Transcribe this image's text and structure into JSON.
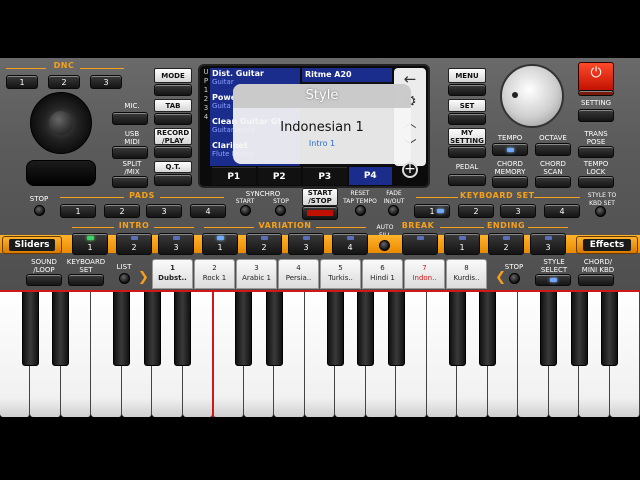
{
  "dnc": {
    "label": "DNC",
    "buttons": [
      "1",
      "2",
      "3"
    ]
  },
  "left": {
    "mic_label": "MIC.",
    "usb_midi_label": "USB\nMIDI",
    "split_mix_label": "SPLIT\n/MIX"
  },
  "mid_buttons": {
    "mode": "MODE",
    "tab": "TAB",
    "record_play": "RECORD\n/PLAY",
    "qt": "Q.T."
  },
  "screen": {
    "list": [
      {
        "name": "Dist. Guitar",
        "sub": "Guitar"
      },
      {
        "name": "Powe",
        "sub": "Guita"
      },
      {
        "name": "Clean Guitar Gt",
        "sub": "Guitar amily"
      },
      {
        "name": "Clarinet",
        "sub": "Flute Family"
      }
    ],
    "rhythm_label": "Ritme A20",
    "side_marks": [
      "U",
      "P",
      "1",
      "2",
      "3",
      "4"
    ],
    "tabs": [
      "P1",
      "P2",
      "P3",
      "P4"
    ],
    "active_tab": "P4",
    "popup_title": "Style",
    "popup_name": "Indonesian 1",
    "popup_sub": "Intro 1"
  },
  "right": {
    "menu": "MENU",
    "set": "SET",
    "my_setting": "MY\nSETTING",
    "pedal": "PEDAL",
    "setting": "SETTING",
    "tempo": "TEMPO",
    "octave": "OCTAVE",
    "transpose": "TRANS\nPOSE",
    "chord_memory": "CHORD\nMEMORY",
    "chord_scan": "CHORD\nSCAN",
    "tempo_lock": "TEMPO\nLOCK"
  },
  "pads": {
    "label": "PADS",
    "stop_label": "STOP",
    "buttons": [
      "1",
      "2",
      "3",
      "4"
    ]
  },
  "start_stop": "START\n/STOP",
  "synchro": {
    "label": "SYNCHRO",
    "start": "START",
    "stop": "STOP"
  },
  "reset": "RESET\nTAP TEMPO",
  "fade": "FADE\nIN/OUT",
  "keyboard_set": {
    "label": "KEYBOARD SET",
    "buttons": [
      "1",
      "2",
      "3",
      "4"
    ],
    "style_to": "STYLE TO\nKBD SET"
  },
  "intro": {
    "label": "INTRO",
    "buttons": [
      "1",
      "2",
      "3"
    ]
  },
  "variation": {
    "label": "VARIATION",
    "buttons": [
      "1",
      "2",
      "3",
      "4"
    ]
  },
  "auto_fill": "AUTO\nFILL",
  "break": {
    "label": "BREAK"
  },
  "ending": {
    "label": "ENDING",
    "buttons": [
      "1",
      "2",
      "3"
    ]
  },
  "sliders": "Sliders",
  "effects": "Effects",
  "bottom": {
    "sound_loop": "SOUND\n/LOOP",
    "keyboard_set": "KEYBOARD\nSET",
    "list": "LIST",
    "stop": "STOP",
    "style_select": "STYLE\nSELECT",
    "chord_mini": "CHORD/\nMINI KBD"
  },
  "styles": [
    {
      "num": "1",
      "name": "Dubst.."
    },
    {
      "num": "2",
      "name": "Rock 1"
    },
    {
      "num": "3",
      "name": "Arabic 1"
    },
    {
      "num": "4",
      "name": "Persia.."
    },
    {
      "num": "5",
      "name": "Turkis.."
    },
    {
      "num": "6",
      "name": "Hindi 1"
    },
    {
      "num": "7",
      "name": "Indon.."
    },
    {
      "num": "8",
      "name": "Kurdis.."
    }
  ],
  "colors": {
    "accent": "#f7a11a",
    "active_style": "#d01818",
    "screen_blue": "#1b2d8c"
  }
}
